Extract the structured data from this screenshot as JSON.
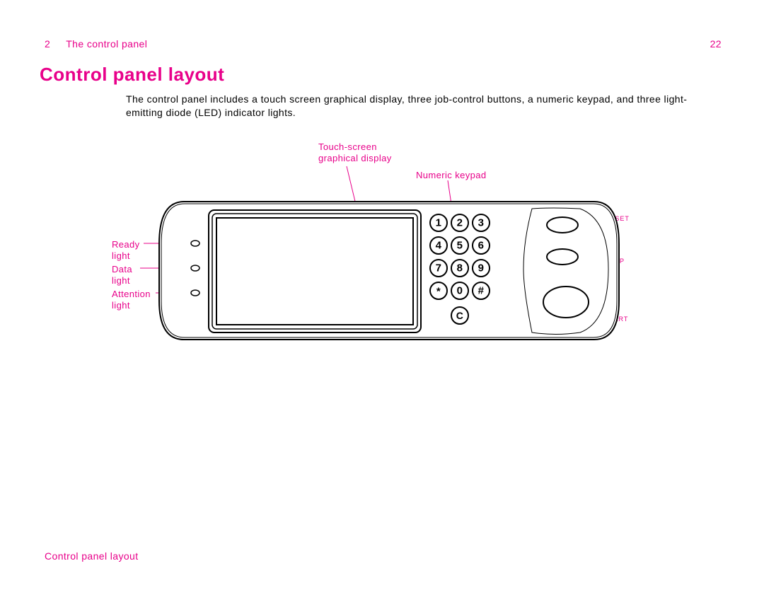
{
  "header": {
    "chapter_number": "2",
    "chapter_title": "The control panel",
    "page_number": "22"
  },
  "section": {
    "title": "Control panel layout",
    "body": "The control panel includes a touch screen graphical display, three job-control buttons, a numeric keypad, and three light-emitting diode (LED) indicator lights."
  },
  "labels": {
    "touch_screen": "Touch-screen graphical display",
    "numeric_keypad": "Numeric keypad",
    "ready_light": "Ready light",
    "data_light": "Data light",
    "attention_light": "Attention light",
    "reset": "Reset",
    "stop": "Stop",
    "start": "Start"
  },
  "keypad": {
    "k1": "1",
    "k2": "2",
    "k3": "3",
    "k4": "4",
    "k5": "5",
    "k6": "6",
    "k7": "7",
    "k8": "8",
    "k9": "9",
    "kstar": "*",
    "k0": "0",
    "khash": "#",
    "kc": "C"
  },
  "footer": {
    "text": "Control panel layout"
  }
}
